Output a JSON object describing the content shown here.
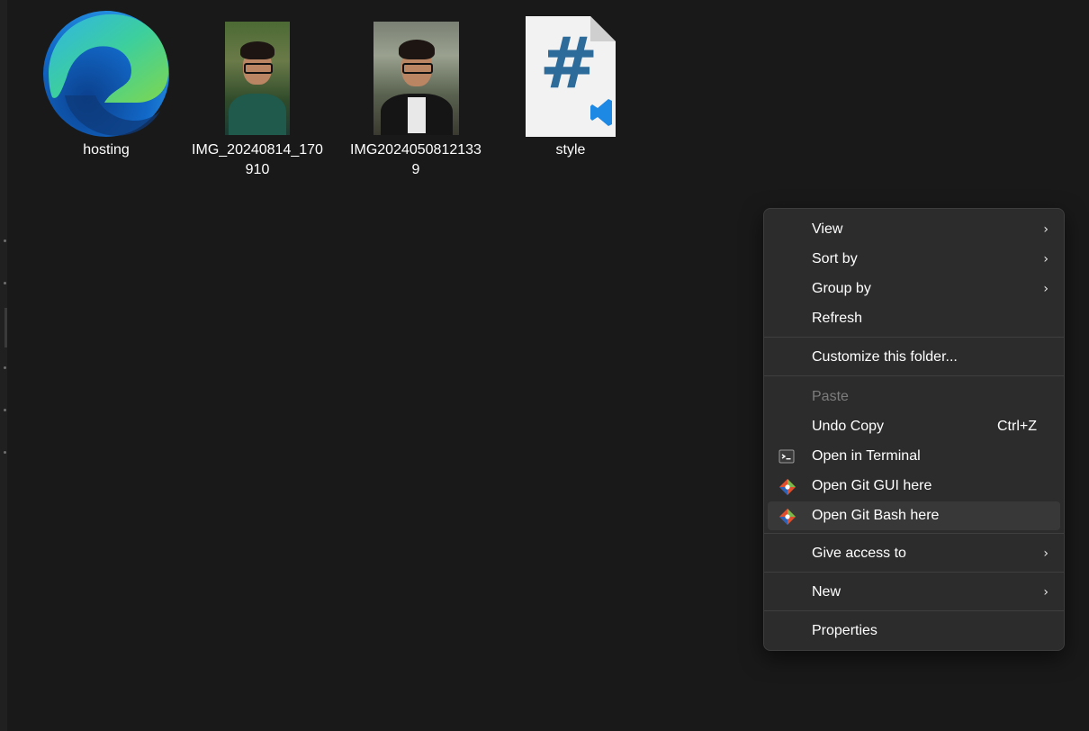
{
  "files": [
    {
      "name": "hosting",
      "icon": "edge-icon"
    },
    {
      "name": "IMG_20240814_170910",
      "icon": "photo-thumbnail"
    },
    {
      "name": "IMG20240508121339",
      "icon": "photo-thumbnail"
    },
    {
      "name": "style",
      "icon": "css-file-icon"
    }
  ],
  "css_icon_glyph": "#",
  "context_menu": {
    "view": "View",
    "sort_by": "Sort by",
    "group_by": "Group by",
    "refresh": "Refresh",
    "customize": "Customize this folder...",
    "paste": "Paste",
    "undo_copy": "Undo Copy",
    "undo_shortcut": "Ctrl+Z",
    "open_terminal": "Open in Terminal",
    "open_git_gui": "Open Git GUI here",
    "open_git_bash": "Open Git Bash here",
    "give_access": "Give access to",
    "new": "New",
    "properties": "Properties"
  },
  "colors": {
    "background": "#191919",
    "menu_background": "#2c2c2c",
    "menu_hover": "#383838",
    "git_orange": "#e24e2b",
    "git_green": "#79b84a",
    "git_blue": "#2c63b8",
    "edge_blue": "#1a7fd4",
    "edge_green": "#4ecf6c"
  }
}
